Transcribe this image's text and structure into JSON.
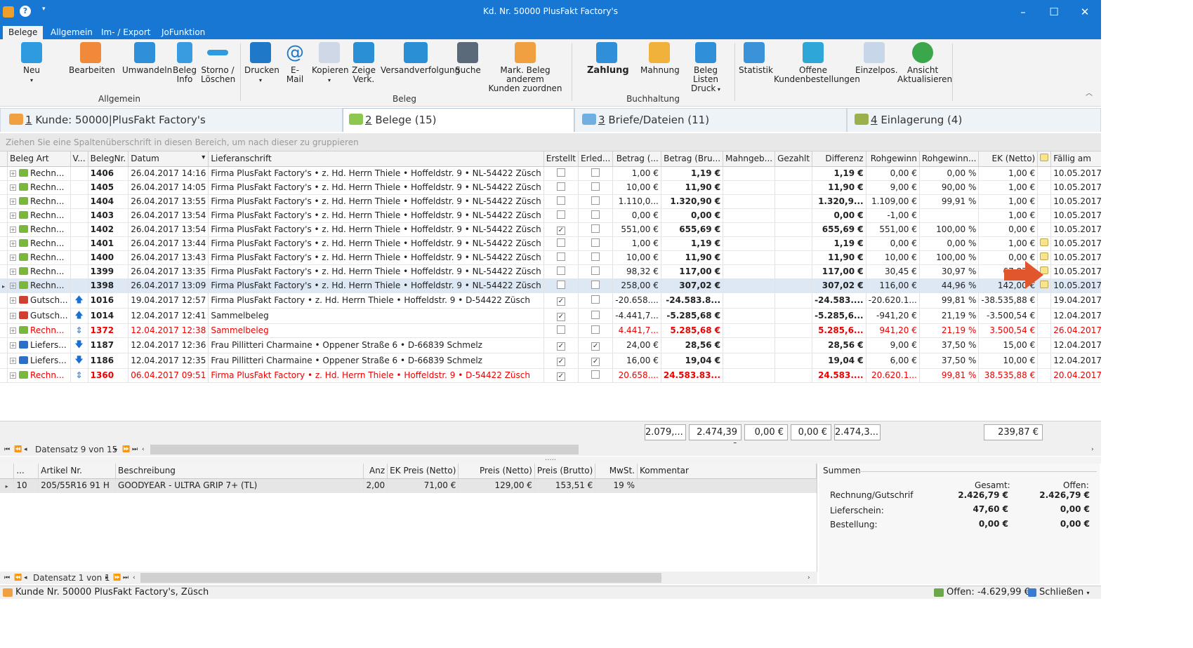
{
  "window": {
    "title": "Kd. Nr. 50000 PlusFakt Factory's",
    "minimize": "–",
    "maximize": "☐",
    "close": "✕"
  },
  "menu": {
    "tabs": [
      "Belege",
      "Allgemein",
      "Im- / Export",
      "JoFunktion"
    ]
  },
  "ribbon": {
    "buttons": [
      "Neu",
      "Bearbeiten",
      "Umwandeln",
      "Beleg\nInfo",
      "Storno /\nLöschen",
      "Drucken",
      "E-Mail",
      "Kopieren",
      "Zeige\nVerk.",
      "Versandverfolgung",
      "Suche",
      "Mark. Beleg anderem\nKunden zuordnen",
      "Zahlung",
      "Mahnung",
      "Beleg Listen\nDruck",
      "Statistik",
      "Offene\nKundenbestellungen",
      "Einzelpos.",
      "Ansicht\nAktualisieren"
    ],
    "groups": [
      "Allgemein",
      "Beleg",
      "Buchhaltung"
    ]
  },
  "panel_tabs": [
    {
      "num": "1",
      "label": " Kunde: 50000|PlusFakt Factory's"
    },
    {
      "num": "2",
      "label": " Belege (15)"
    },
    {
      "num": "3",
      "label": " Briefe/Dateien (11)"
    },
    {
      "num": "4",
      "label": " Einlagerung (4)"
    }
  ],
  "group_hint": "Ziehen Sie eine Spaltenüberschrift in diesen Bereich, um nach dieser zu gruppieren",
  "grid": {
    "columns": [
      "Beleg Art",
      "V...",
      "BelegNr.",
      "Datum",
      "Lieferanschrift",
      "Erstellt",
      "Erled...",
      "Betrag (...",
      "Betrag (Bru...",
      "Mahngeb...",
      "Gezahlt",
      "Differenz",
      "Rohgewinn",
      "Rohgewinn...",
      "EK (Netto)",
      "",
      "Fällig am"
    ],
    "rows": [
      {
        "art": "Rechn...",
        "nr": "1406",
        "datum": "26.04.2017 14:16",
        "anschrift": "Firma PlusFakt Factory's • z. Hd. Herrn Thiele • Hoffeldstr. 9 • NL-54422 Züsch",
        "erstellt": false,
        "erled": false,
        "netto": "1,00 €",
        "brutto": "1,19 €",
        "mahn": "",
        "gezahlt": "",
        "diff": "1,19 €",
        "roh": "0,00 €",
        "rohp": "0,00 %",
        "ek": "1,00 €",
        "note": false,
        "faellig": "10.05.2017"
      },
      {
        "art": "Rechn...",
        "nr": "1405",
        "datum": "26.04.2017 14:05",
        "anschrift": "Firma PlusFakt Factory's • z. Hd. Herrn Thiele • Hoffeldstr. 9 • NL-54422 Züsch",
        "erstellt": false,
        "erled": false,
        "netto": "10,00 €",
        "brutto": "11,90 €",
        "mahn": "",
        "gezahlt": "",
        "diff": "11,90 €",
        "roh": "9,00 €",
        "rohp": "90,00 %",
        "ek": "1,00 €",
        "note": false,
        "faellig": "10.05.2017"
      },
      {
        "art": "Rechn...",
        "nr": "1404",
        "datum": "26.04.2017 13:55",
        "anschrift": "Firma PlusFakt Factory's • z. Hd. Herrn Thiele • Hoffeldstr. 9 • NL-54422 Züsch",
        "erstellt": false,
        "erled": false,
        "netto": "1.110,0...",
        "brutto": "1.320,90 €",
        "mahn": "",
        "gezahlt": "",
        "diff": "1.320,9...",
        "roh": "1.109,00 €",
        "rohp": "99,91 %",
        "ek": "1,00 €",
        "note": false,
        "faellig": "10.05.2017"
      },
      {
        "art": "Rechn...",
        "nr": "1403",
        "datum": "26.04.2017 13:54",
        "anschrift": "Firma PlusFakt Factory's • z. Hd. Herrn Thiele • Hoffeldstr. 9 • NL-54422 Züsch",
        "erstellt": false,
        "erled": false,
        "netto": "0,00 €",
        "brutto": "0,00 €",
        "mahn": "",
        "gezahlt": "",
        "diff": "0,00 €",
        "roh": "-1,00 €",
        "rohp": "",
        "ek": "1,00 €",
        "note": false,
        "faellig": "10.05.2017"
      },
      {
        "art": "Rechn...",
        "nr": "1402",
        "datum": "26.04.2017 13:54",
        "anschrift": "Firma PlusFakt Factory's • z. Hd. Herrn Thiele • Hoffeldstr. 9 • NL-54422 Züsch",
        "erstellt": true,
        "erled": false,
        "netto": "551,00 €",
        "brutto": "655,69 €",
        "mahn": "",
        "gezahlt": "",
        "diff": "655,69 €",
        "roh": "551,00 €",
        "rohp": "100,00 %",
        "ek": "0,00 €",
        "note": false,
        "faellig": "10.05.2017"
      },
      {
        "art": "Rechn...",
        "nr": "1401",
        "datum": "26.04.2017 13:44",
        "anschrift": "Firma PlusFakt Factory's • z. Hd. Herrn Thiele • Hoffeldstr. 9 • NL-54422 Züsch",
        "erstellt": false,
        "erled": false,
        "netto": "1,00 €",
        "brutto": "1,19 €",
        "mahn": "",
        "gezahlt": "",
        "diff": "1,19 €",
        "roh": "0,00 €",
        "rohp": "0,00 %",
        "ek": "1,00 €",
        "note": true,
        "faellig": "10.05.2017"
      },
      {
        "art": "Rechn...",
        "nr": "1400",
        "datum": "26.04.2017 13:43",
        "anschrift": "Firma PlusFakt Factory's • z. Hd. Herrn Thiele • Hoffeldstr. 9 • NL-54422 Züsch",
        "erstellt": false,
        "erled": false,
        "netto": "10,00 €",
        "brutto": "11,90 €",
        "mahn": "",
        "gezahlt": "",
        "diff": "11,90 €",
        "roh": "10,00 €",
        "rohp": "100,00 %",
        "ek": "0,00 €",
        "note": true,
        "faellig": "10.05.2017"
      },
      {
        "art": "Rechn...",
        "nr": "1399",
        "datum": "26.04.2017 13:35",
        "anschrift": "Firma PlusFakt Factory's • z. Hd. Herrn Thiele • Hoffeldstr. 9 • NL-54422 Züsch",
        "erstellt": false,
        "erled": false,
        "netto": "98,32 €",
        "brutto": "117,00 €",
        "mahn": "",
        "gezahlt": "",
        "diff": "117,00 €",
        "roh": "30,45 €",
        "rohp": "30,97 %",
        "ek": "67,87 €",
        "note": true,
        "faellig": "10.05.2017"
      },
      {
        "art": "Rechn...",
        "nr": "1398",
        "datum": "26.04.2017 13:09",
        "anschrift": "Firma PlusFakt Factory's • z. Hd. Herrn Thiele • Hoffeldstr. 9 • NL-54422 Züsch",
        "erstellt": false,
        "erled": false,
        "netto": "258,00 €",
        "brutto": "307,02 €",
        "mahn": "",
        "gezahlt": "",
        "diff": "307,02 €",
        "roh": "116,00 €",
        "rohp": "44,96 %",
        "ek": "142,00 €",
        "note": true,
        "faellig": "10.05.2017",
        "selected": true
      },
      {
        "art": "Gutsch...",
        "nr": "1016",
        "datum": "19.04.2017 12:57",
        "anschrift": "Firma PlusFakt Factory • z. Hd. Herrn Thiele • Hoffeldstr. 9 • D-54422 Züsch",
        "erstellt": true,
        "erled": false,
        "netto": "-20.658....",
        "brutto": "-24.583.8...",
        "mahn": "",
        "gezahlt": "",
        "diff": "-24.583....",
        "roh": "-20.620.1...",
        "rohp": "99,81 %",
        "ek": "-38.535,88 €",
        "note": false,
        "faellig": "19.04.2017",
        "dir": "up"
      },
      {
        "art": "Gutsch...",
        "nr": "1014",
        "datum": "12.04.2017 12:41",
        "anschrift": "Sammelbeleg",
        "erstellt": true,
        "erled": false,
        "netto": "-4.441,7...",
        "brutto": "-5.285,68 €",
        "mahn": "",
        "gezahlt": "",
        "diff": "-5.285,6...",
        "roh": "-941,20 €",
        "rohp": "21,19 %",
        "ek": "-3.500,54 €",
        "note": false,
        "faellig": "12.04.2017",
        "dir": "up"
      },
      {
        "art": "Rechn...",
        "nr": "1372",
        "datum": "12.04.2017 12:38",
        "anschrift": "Sammelbeleg",
        "erstellt": false,
        "erled": false,
        "netto": "4.441,7...",
        "brutto": "5.285,68 €",
        "mahn": "",
        "gezahlt": "",
        "diff": "5.285,6...",
        "roh": "941,20 €",
        "rohp": "21,19 %",
        "ek": "3.500,54 €",
        "note": false,
        "faellig": "26.04.2017",
        "dir": "both",
        "red": true
      },
      {
        "art": "Liefers...",
        "nr": "1187",
        "datum": "12.04.2017 12:36",
        "anschrift": "Frau Pillitteri Charmaine • Oppener Straße 6 • D-66839 Schmelz",
        "erstellt": true,
        "erled": true,
        "netto": "24,00 €",
        "brutto": "28,56 €",
        "mahn": "",
        "gezahlt": "",
        "diff": "28,56 €",
        "roh": "9,00 €",
        "rohp": "37,50 %",
        "ek": "15,00 €",
        "note": false,
        "faellig": "12.04.2017",
        "dir": "down"
      },
      {
        "art": "Liefers...",
        "nr": "1186",
        "datum": "12.04.2017 12:35",
        "anschrift": "Frau Pillitteri Charmaine • Oppener Straße 6 • D-66839 Schmelz",
        "erstellt": true,
        "erled": true,
        "netto": "16,00 €",
        "brutto": "19,04 €",
        "mahn": "",
        "gezahlt": "",
        "diff": "19,04 €",
        "roh": "6,00 €",
        "rohp": "37,50 %",
        "ek": "10,00 €",
        "note": false,
        "faellig": "12.04.2017",
        "dir": "down"
      },
      {
        "art": "Rechn...",
        "nr": "1360",
        "datum": "06.04.2017 09:51",
        "anschrift": "Firma PlusFakt Factory • z. Hd. Herrn Thiele • Hoffeldstr. 9 • D-54422 Züsch",
        "erstellt": true,
        "erled": false,
        "netto": "20.658....",
        "brutto": "24.583.83...",
        "mahn": "",
        "gezahlt": "",
        "diff": "24.583....",
        "roh": "20.620.1...",
        "rohp": "99,81 %",
        "ek": "38.535,88 €",
        "note": false,
        "faellig": "20.04.2017",
        "dir": "both",
        "red": true
      }
    ],
    "totals": {
      "netto": "2.079,...",
      "brutto": "2.474,39 €",
      "mahn": "0,00 €",
      "gezahlt": "0,00 €",
      "diff": "2.474,3...",
      "ek": "239,87 €"
    },
    "nav": "Datensatz 9 von 15"
  },
  "detail": {
    "columns": [
      "...",
      "Artikel Nr.",
      "Beschreibung",
      "Anz",
      "EK Preis (Netto)",
      "Preis (Netto)",
      "Preis (Brutto)",
      "MwSt.",
      "Kommentar"
    ],
    "rows": [
      {
        "pos": "10",
        "artikel": "205/55R16 91 H",
        "beschreibung": "GOODYEAR - ULTRA GRIP 7+ (TL)",
        "anz": "2,00",
        "ek": "71,00 €",
        "netto": "129,00 €",
        "brutto": "153,51 €",
        "mwst": "19 %",
        "kommentar": ""
      }
    ],
    "nav": "Datensatz 1 von 1"
  },
  "summen": {
    "title": "Summen",
    "head_gesamt": "Gesamt:",
    "head_offen": "Offen:",
    "rows": [
      {
        "label": "Rechnung/Gutschrif",
        "gesamt": "2.426,79 €",
        "offen": "2.426,79 €"
      },
      {
        "label": "Lieferschein:",
        "gesamt": "47,60 €",
        "offen": "0,00 €"
      },
      {
        "label": "Bestellung:",
        "gesamt": "0,00 €",
        "offen": "0,00 €"
      }
    ]
  },
  "status": {
    "left": "Kunde Nr. 50000 PlusFakt Factory's, Züsch",
    "offen": "Offen: -4.629,99 €",
    "close": "Schließen"
  },
  "colors": {
    "accent": "#1777d3",
    "red": "#e00000",
    "arrow": "#e2562e"
  }
}
